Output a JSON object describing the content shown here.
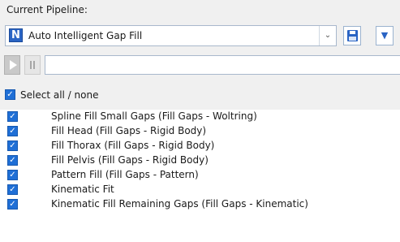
{
  "header": {
    "current_pipeline_label": "Current Pipeline:"
  },
  "pipeline": {
    "name": "Auto Intelligent Gap Fill",
    "icon": "N"
  },
  "selection": {
    "select_all_label": "Select all / none",
    "checked": true
  },
  "operations": [
    {
      "label": "Spline Fill Small Gaps (Fill Gaps - Woltring)",
      "checked": true
    },
    {
      "label": "Fill Head (Fill Gaps - Rigid Body)",
      "checked": true
    },
    {
      "label": "Fill Thorax (Fill Gaps - Rigid Body)",
      "checked": true
    },
    {
      "label": "Fill Pelvis (Fill Gaps - Rigid Body)",
      "checked": true
    },
    {
      "label": "Pattern Fill (Fill Gaps - Pattern)",
      "checked": true
    },
    {
      "label": "Kinematic Fit",
      "checked": true
    },
    {
      "label": "Kinematic Fill Remaining Gaps (Fill Gaps - Kinematic)",
      "checked": true
    }
  ],
  "colors": {
    "accent": "#1f6fd6",
    "icon_blue": "#2a64c4"
  }
}
